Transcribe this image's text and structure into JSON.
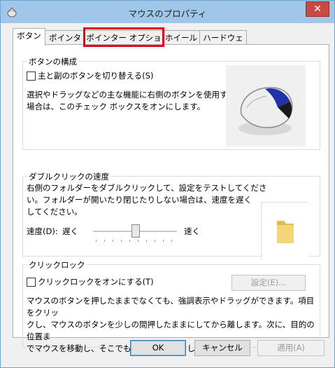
{
  "window": {
    "title": "マウスのプロパティ",
    "close_glyph": "✕"
  },
  "tabs": [
    {
      "label": "ボタン"
    },
    {
      "label": "ポインター"
    },
    {
      "label": "ポインター オプション"
    },
    {
      "label": "ホイール"
    },
    {
      "label": "ハードウェア"
    }
  ],
  "button_config": {
    "title": "ボタンの構成",
    "checkbox_label": "主と副のボタンを切り替える(S)",
    "description_line1": "選択やドラッグなどの主な機能に右側のボタンを使用する",
    "description_line2": "場合は、このチェック ボックスをオンにします。"
  },
  "double_click": {
    "title": "ダブルクリックの速度",
    "description_line1": "右側のフォルダーをダブルクリックして、設定をテストしてくださ",
    "description_line2": "い。フォルダーが開いたり閉じたりしない場合は、速度を遅く",
    "description_line3": "してください。",
    "speed_label": "速度(D):",
    "slow_label": "遅く",
    "fast_label": "速く",
    "speed_value": 0.5
  },
  "click_lock": {
    "title": "クリックロック",
    "checkbox_label": "クリックロックをオンにする(T)",
    "settings_button": "設定(E)...",
    "description_line1": "マウスのボタンを押したままでなくても、強調表示やドラッグができます。項目をクリッ",
    "description_line2": "クし、マウスのボタンを少しの間押したままにしてから離します。次に、目的の位置ま",
    "description_line3": "でマウスを移動し、そこでもう一度クリックします。"
  },
  "footer": {
    "ok": "OK",
    "cancel": "キャンセル",
    "apply": "適用(A)"
  }
}
